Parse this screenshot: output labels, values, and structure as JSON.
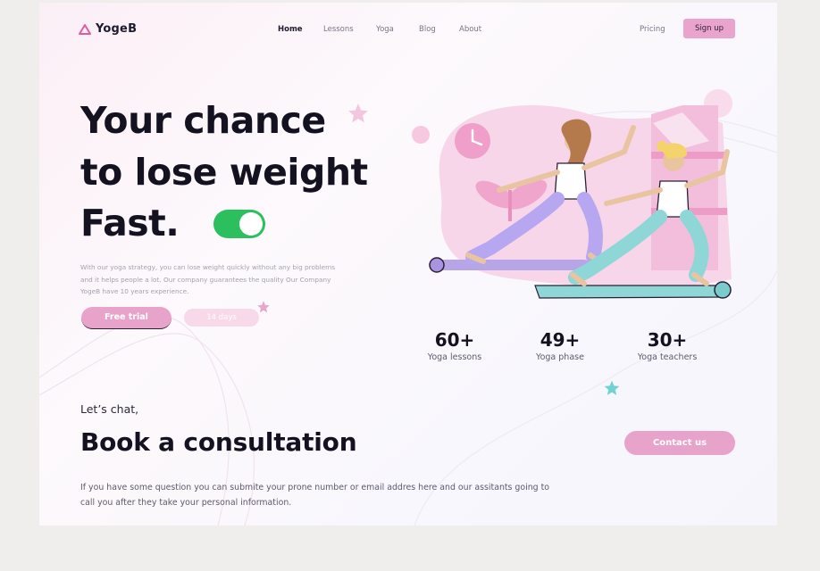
{
  "header": {
    "logo_text": "YogeB",
    "nav": [
      "Home",
      "Lessons",
      "Yoga",
      "Blog",
      "About"
    ],
    "pricing": "Pricing",
    "signup": "Sign up"
  },
  "hero": {
    "title_lines": [
      "Your chance",
      "to lose weight",
      "Fast."
    ],
    "description": "With our yoga strategy, you can lose weight quickly without any big problems and it helps people a lot. Our company guarantees the quality Our Company YogeB have 10 years experience.",
    "primary_button": "Free trial",
    "secondary_button": "14 days",
    "toggle_on": true
  },
  "stats": [
    {
      "value": "60+",
      "label": "Yoga lessons"
    },
    {
      "value": "49+",
      "label": "Yoga phase"
    },
    {
      "value": "30+",
      "label": "Yoga teachers"
    }
  ],
  "consultation": {
    "kicker": "Let’s chat,",
    "title": "Book  a consultation",
    "description": "If you have some question you can submite your prone number or email addres here and our assitants going to call you after they take your personal information.",
    "button": "Contact us"
  },
  "colors": {
    "accent_pink": "#e8a3cb",
    "toggle_green": "#2bbf5e",
    "star_pink": "#e7a6cb",
    "star_teal": "#6fd3d3"
  },
  "icons": [
    "logo-triangle-icon",
    "star-icon"
  ]
}
